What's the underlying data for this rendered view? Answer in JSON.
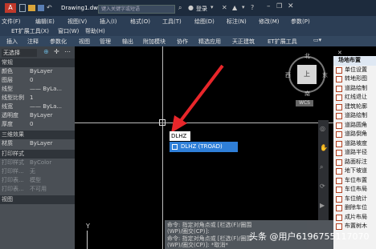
{
  "title": {
    "tab": "Drawing1.dwg",
    "search_placeholder": "键入关键字或短语",
    "login": "登录"
  },
  "menu1": [
    "文件(F)",
    "编辑(E)",
    "视图(V)",
    "插入(I)",
    "格式(O)",
    "工具(T)",
    "绘图(D)",
    "标注(N)",
    "修改(M)",
    "参数(P)"
  ],
  "menu2": [
    "ET扩展工具(X)",
    "窗口(W)",
    "帮助(H)"
  ],
  "ribbon": [
    "插入",
    "注释",
    "参数化",
    "视图",
    "管理",
    "输出",
    "附加模块",
    "协作",
    "精选应用",
    "天正建筑",
    "ET扩展工具"
  ],
  "left_panel": {
    "top_field": "无选择",
    "section_basic": "常规",
    "rows": [
      {
        "k": "颜色",
        "v": "ByLayer"
      },
      {
        "k": "图层",
        "v": "0"
      },
      {
        "k": "线型",
        "v": "—— ByLa..."
      },
      {
        "k": "线型比例",
        "v": "1"
      },
      {
        "k": "线宽",
        "v": "—— ByLa..."
      },
      {
        "k": "透明度",
        "v": "ByLayer"
      },
      {
        "k": "厚度",
        "v": "0"
      }
    ],
    "section_3d": "三维效果",
    "rows_3d": [
      {
        "k": "材质",
        "v": "ByLayer"
      }
    ],
    "section_print": "打印样式",
    "rows_print": [
      {
        "k": "打印样式",
        "v": "ByColor"
      },
      {
        "k": "打印样...",
        "v": "无"
      },
      {
        "k": "打印表...",
        "v": "模型"
      },
      {
        "k": "打印表...",
        "v": "不可用"
      }
    ],
    "section_view": "视图"
  },
  "viewcube": {
    "north": "北",
    "south": "南",
    "east": "东",
    "west": "西",
    "center": "上",
    "wcs": "WCS"
  },
  "command_input": "DLHZ",
  "autocomplete": "DLHZ (TROAD)",
  "right_panel": {
    "header": "场地布置",
    "items": [
      "单位设置",
      "转地形图",
      "道路绘制",
      "红线退让",
      "建筑轮廓",
      "道路绘制",
      "道路圆角",
      "道路倒角",
      "道路坡度",
      "道路半径",
      "路面标注",
      "地下坡道",
      "车位布置",
      "车位布局",
      "车位统计",
      "删除车位",
      "成片布局",
      "布置树木"
    ]
  },
  "command_lines": [
    "命令: 指定对角点或 [栏选(F)/圈围",
    "(WP)/圈交(CP)]:",
    "命令: 指定对角点或 [栏选(F)/圈围",
    "(WP)/圈交(CP)]: *取消*"
  ],
  "axis_y": "Y",
  "watermark": "头条 @用户6196755117070"
}
